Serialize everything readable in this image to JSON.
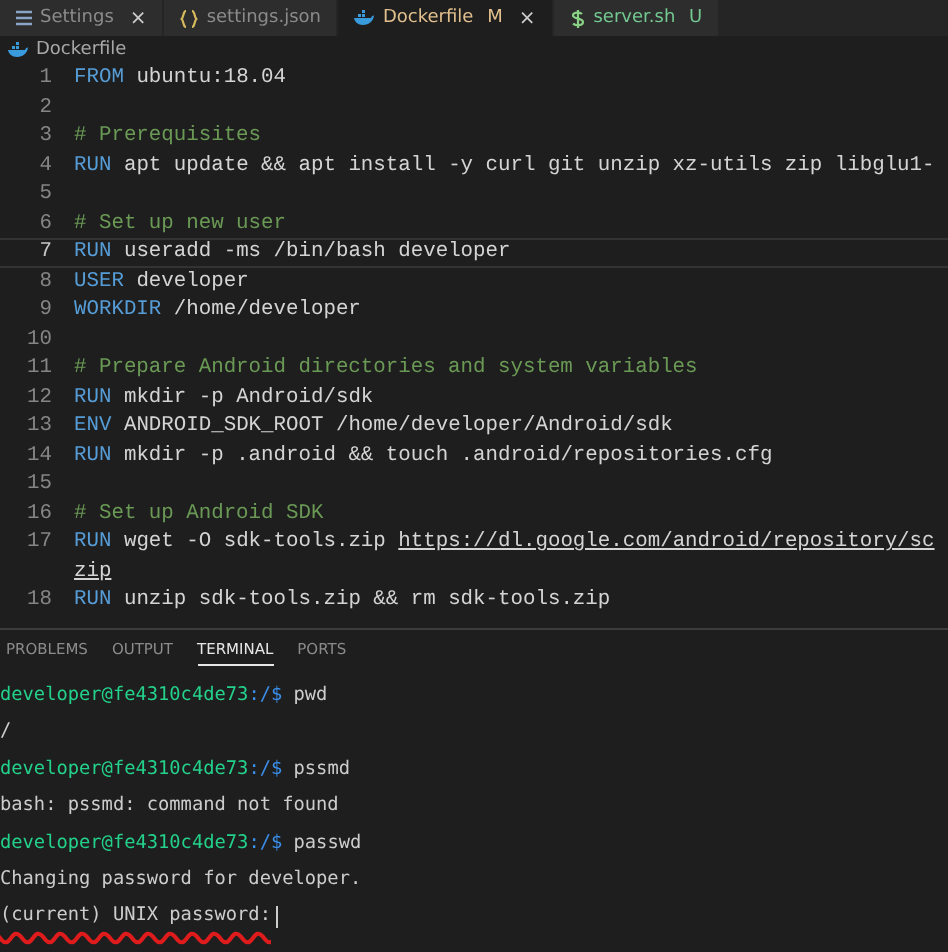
{
  "tabs": [
    {
      "label": "Settings",
      "selected": false,
      "close": "×"
    },
    {
      "label": "settings.json",
      "selected": false
    },
    {
      "label": "Dockerfile",
      "badge": "M",
      "color": "#e2c08d",
      "selected": true,
      "close": "×"
    },
    {
      "label": "server.sh",
      "badge": "U",
      "color": "#73c991",
      "selected": false
    }
  ],
  "breadcrumb": {
    "label": "Dockerfile"
  },
  "code_lines": [
    {
      "number": "1",
      "current": false,
      "segments": [
        {
          "kind": "keyword",
          "text": "FROM"
        },
        {
          "kind": "plain",
          "text": " ubuntu:18.04"
        }
      ]
    },
    {
      "number": "2",
      "current": false
    },
    {
      "number": "3",
      "current": false,
      "segments": [
        {
          "kind": "comment",
          "text": "# Prerequisites"
        }
      ]
    },
    {
      "number": "4",
      "current": false,
      "segments": [
        {
          "kind": "keyword",
          "text": "RUN"
        },
        {
          "kind": "plain",
          "text": " apt update && apt install -y curl git unzip xz-utils zip libglu1-"
        }
      ]
    },
    {
      "number": "5",
      "current": false
    },
    {
      "number": "6",
      "current": false,
      "segments": [
        {
          "kind": "comment",
          "text": "# Set up new user"
        }
      ]
    },
    {
      "number": "7",
      "current": true,
      "segments": [
        {
          "kind": "keyword",
          "text": "RUN"
        },
        {
          "kind": "plain",
          "text": " useradd -ms /bin/bash developer"
        }
      ]
    },
    {
      "number": "8",
      "current": false,
      "segments": [
        {
          "kind": "keyword",
          "text": "USER"
        },
        {
          "kind": "plain",
          "text": " developer"
        }
      ]
    },
    {
      "number": "9",
      "current": false,
      "segments": [
        {
          "kind": "keyword",
          "text": "WORKDIR"
        },
        {
          "kind": "plain",
          "text": " /home/developer"
        }
      ]
    },
    {
      "number": "10",
      "current": false
    },
    {
      "number": "11",
      "current": false,
      "segments": [
        {
          "kind": "comment",
          "text": "# Prepare Android directories and system variables"
        }
      ]
    },
    {
      "number": "12",
      "current": false,
      "segments": [
        {
          "kind": "keyword",
          "text": "RUN"
        },
        {
          "kind": "plain",
          "text": " mkdir -p Android/sdk"
        }
      ]
    },
    {
      "number": "13",
      "current": false,
      "segments": [
        {
          "kind": "keyword",
          "text": "ENV"
        },
        {
          "kind": "plain",
          "text": " ANDROID_SDK_ROOT /home/developer/Android/sdk"
        }
      ]
    },
    {
      "number": "14",
      "current": false,
      "segments": [
        {
          "kind": "keyword",
          "text": "RUN"
        },
        {
          "kind": "plain",
          "text": " mkdir -p .android && touch .android/repositories.cfg"
        }
      ]
    },
    {
      "number": "15",
      "current": false
    },
    {
      "number": "16",
      "current": false,
      "segments": [
        {
          "kind": "comment",
          "text": "# Set up Android SDK"
        }
      ]
    },
    {
      "number": "17",
      "current": false,
      "segments": [
        {
          "kind": "keyword",
          "text": "RUN"
        },
        {
          "kind": "plain",
          "text": " wget -O sdk-tools.zip "
        },
        {
          "kind": "link",
          "text": "https://dl.google.com/android/repository/sc"
        }
      ],
      "wrap": [
        {
          "kind": "link",
          "text": "zip"
        }
      ]
    },
    {
      "number": "18",
      "current": false,
      "segments": [
        {
          "kind": "keyword",
          "text": "RUN"
        },
        {
          "kind": "plain",
          "text": " unzip sdk-tools.zip && rm sdk-tools.zip"
        }
      ]
    }
  ],
  "panel_tabs": [
    {
      "label": "PROBLEMS",
      "selected": false
    },
    {
      "label": "OUTPUT",
      "selected": false
    },
    {
      "label": "TERMINAL",
      "selected": true
    },
    {
      "label": "PORTS",
      "selected": false
    }
  ],
  "terminal_lines": [
    {
      "kind": "prompt",
      "user": "developer@fe4310c4de73",
      "path": ":/$",
      "command": "pwd"
    },
    {
      "kind": "output",
      "text": "/"
    },
    {
      "kind": "prompt",
      "user": "developer@fe4310c4de73",
      "path": ":/$",
      "command": "pssmd"
    },
    {
      "kind": "output",
      "text": "bash: pssmd: command not found"
    },
    {
      "kind": "prompt",
      "user": "developer@fe4310c4de73",
      "path": ":/$",
      "command": "passwd"
    },
    {
      "kind": "output",
      "text": "Changing password for developer."
    },
    {
      "kind": "input",
      "text": "(current) UNIX password:",
      "underlined": true
    }
  ]
}
